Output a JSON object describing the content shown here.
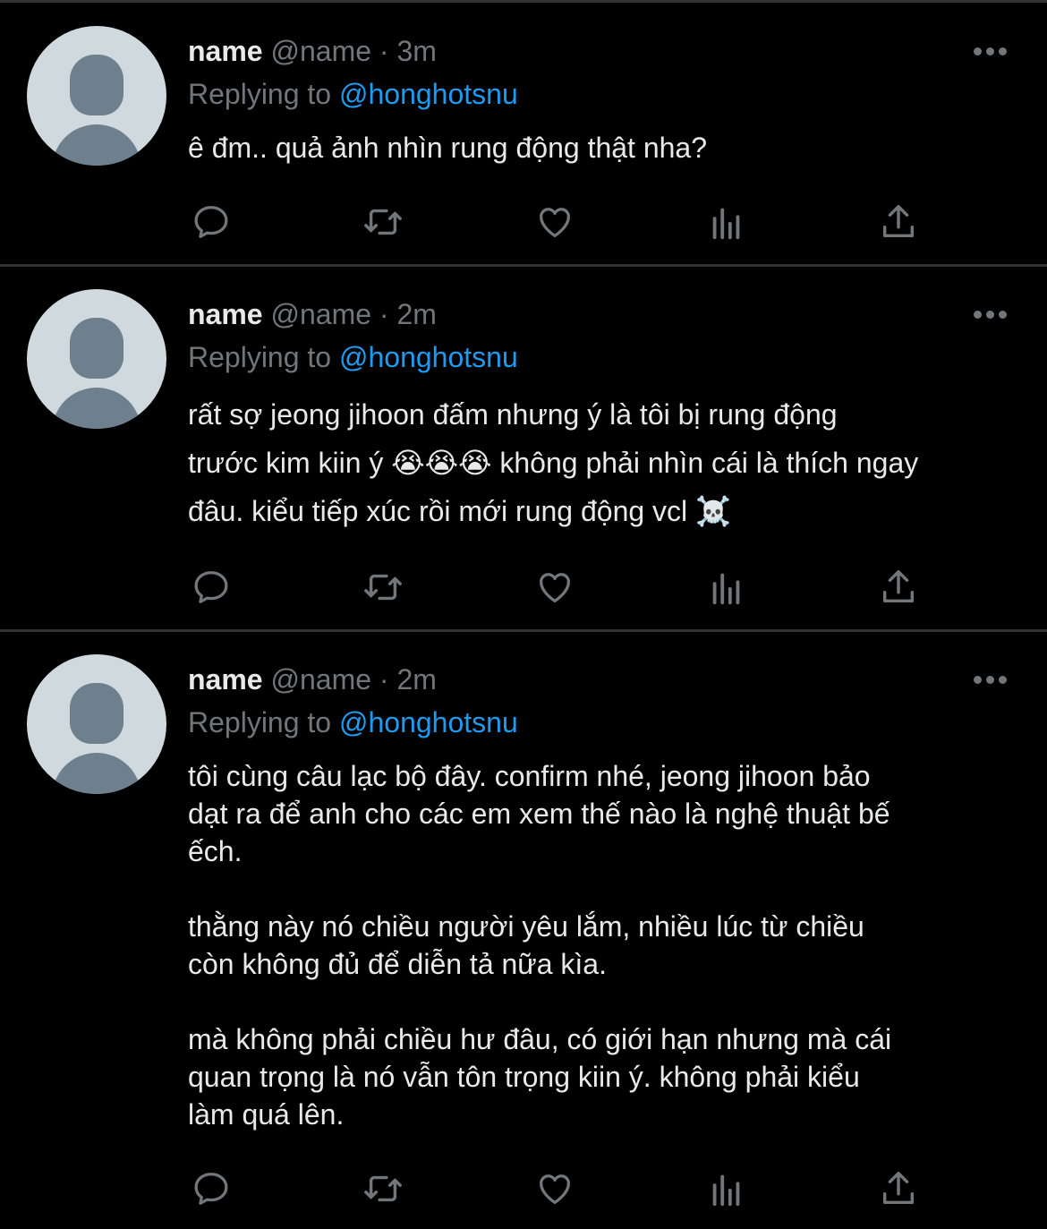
{
  "tweets": [
    {
      "name": "name",
      "handle": "@name",
      "separator": "·",
      "time": "3m",
      "replying_prefix": "Replying to",
      "replying_to": "@honghotsnu",
      "text": "ê đm.. quả ảnh nhìn rung động thật nha?"
    },
    {
      "name": "name",
      "handle": "@name",
      "separator": "·",
      "time": "2m",
      "replying_prefix": "Replying to",
      "replying_to": "@honghotsnu",
      "text": "rất sợ jeong jihoon đấm nhưng ý là tôi bị rung động\ntrước kim kiin ý 😭😭😭 không phải nhìn cái là thích ngay\nđâu. kiểu tiếp xúc rồi mới rung động vcl ☠️"
    },
    {
      "name": "name",
      "handle": "@name",
      "separator": "·",
      "time": "2m",
      "replying_prefix": "Replying to",
      "replying_to": "@honghotsnu",
      "text": "tôi cùng câu lạc bộ đây. confirm nhé, jeong jihoon bảo\ndạt ra để anh cho các em xem thế nào là nghệ thuật bế\nếch.\n\nthằng này nó chiều người yêu lắm, nhiều lúc từ chiều\ncòn không đủ để diễn tả nữa kìa.\n\nmà không phải chiều hư đâu, có giới hạn nhưng mà cái\nquan trọng là nó vẫn tôn trọng kiin ý. không phải kiểu\nlàm quá lên."
    }
  ],
  "icons": {
    "reply": "reply-icon",
    "retweet": "retweet-icon",
    "like": "like-icon",
    "views": "views-icon",
    "share": "share-icon",
    "more": "more-icon"
  },
  "colors": {
    "background": "#000000",
    "text": "#e7e9ea",
    "secondary": "#71767b",
    "mention": "#1d9bf0",
    "divider": "#2f3336"
  }
}
